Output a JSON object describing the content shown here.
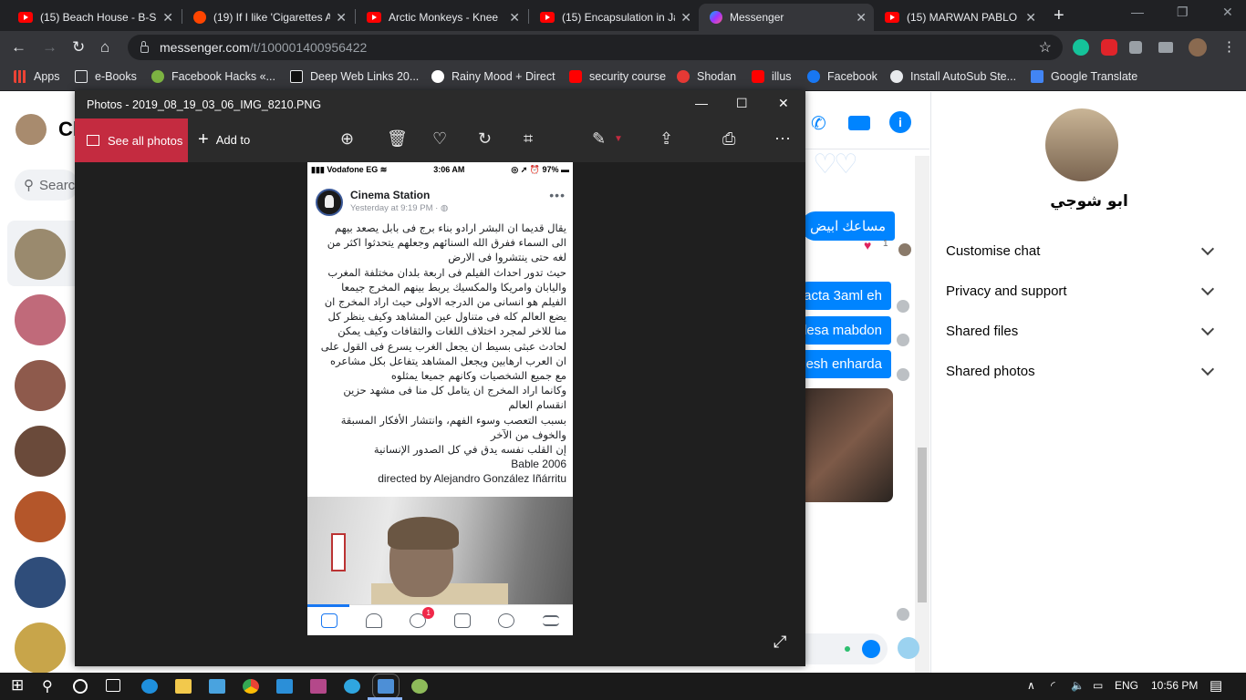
{
  "browser": {
    "tabs": [
      {
        "title": "(15) Beach House - B-Si",
        "icon": "youtube-icon"
      },
      {
        "title": "(19) If I like 'Cigarettes A",
        "icon": "reddit-icon"
      },
      {
        "title": "Arctic Monkeys - Knee",
        "icon": "youtube-icon"
      },
      {
        "title": "(15) Encapsulation in Ja",
        "icon": "youtube-icon"
      },
      {
        "title": "Messenger",
        "icon": "messenger-icon",
        "active": true
      },
      {
        "title": "(15) MARWAN PABLO -",
        "icon": "youtube-icon"
      }
    ],
    "new_tab": "+",
    "url_host": "messenger.com",
    "url_path": "/t/100001400956422",
    "bookmarks": [
      {
        "label": "Apps",
        "icon": "apps-grid-icon"
      },
      {
        "label": "e-Books",
        "icon": "folder-icon"
      },
      {
        "label": "Facebook Hacks «...",
        "icon": "bookmark-icon"
      },
      {
        "label": "Deep Web Links 20...",
        "icon": "bookmark-icon"
      },
      {
        "label": "Rainy Mood + Direct",
        "icon": "bookmark-icon"
      },
      {
        "label": "security course",
        "icon": "youtube-icon"
      },
      {
        "label": "Shodan",
        "icon": "shodan-icon"
      },
      {
        "label": "illus",
        "icon": "youtube-icon"
      },
      {
        "label": "Facebook",
        "icon": "facebook-icon"
      },
      {
        "label": "Install AutoSub Ste...",
        "icon": "github-icon"
      },
      {
        "label": "Google Translate",
        "icon": "translate-icon"
      }
    ]
  },
  "messenger": {
    "title_partial": "Ch",
    "search_placeholder": "Searc",
    "contact_name": "ابو شوجي",
    "messages": [
      {
        "text": "مساعك ابيض"
      },
      {
        "text": "acta 3aml eh"
      },
      {
        "text": "lesa mabdon"
      },
      {
        "text": "nesh enharda"
      }
    ],
    "reaction_count": "1",
    "options": [
      {
        "label": "Customise chat"
      },
      {
        "label": "Privacy and support"
      },
      {
        "label": "Shared files"
      },
      {
        "label": "Shared photos"
      }
    ]
  },
  "photos": {
    "window_title": "Photos - 2019_08_19_03_06_IMG_8210.PNG",
    "see_all": "See all photos",
    "add_to": "Add to",
    "phone": {
      "carrier": "Vodafone EG",
      "time": "3:06 AM",
      "battery": "97%"
    },
    "post": {
      "page_name": "Cinema Station",
      "timestamp": "Yesterday at 9:19 PM ·",
      "lines": [
        "يقال قديما ان البشر ارادو بناء برج فى بابل يصعد بيهم",
        "الى السماء ففرق الله السنائهم وجعلهم يتحدثوا اكثر من",
        "لغه حتى ينتشروا فى الارض",
        "حيث تدور احداث الفيلم فى اربعة بلدان مختلفة المغرب",
        "واليابان وامريكا والمكسيك يربط بينهم المخرج جيمعا",
        " الفيلم هو انسانى من الدرجه الاولى حيث اراد المخرج ان",
        "يضع العالم كله فى متناول عين المشاهد وكيف ينظر كل",
        "منا للاخر لمجرد اختلاف اللغات والثقافات  وكيف يمكن",
        "لحادث عبثى بسيط ان يجعل الغرب يسرع فى القول على",
        "ان العرب ارهابين ويجعل المشاهد يتفاعل بكل مشاعره",
        "مع جميع الشخصيات وكانهم جميعا يمثلوه",
        "وكانما اراد المخرج ان يتامل كل منا فى مشهد حزين",
        "انقسام العالم",
        "بسبب التعصب وسوء الفهم، وانتشار الأفكار المسبقة",
        "والخوف من الآخر",
        "إن القلب نفسه يدق في كل الصدور الإنسانية"
      ],
      "film_line": "Bable 2006",
      "director_line": "directed by Alejandro González Iñárritu"
    },
    "fb_badge": "1"
  },
  "taskbar": {
    "language": "ENG",
    "time": "10:56 PM"
  },
  "colors": {
    "messenger_blue": "#0084ff",
    "photos_accent": "#c42b40",
    "chrome_dark": "#35363a"
  }
}
